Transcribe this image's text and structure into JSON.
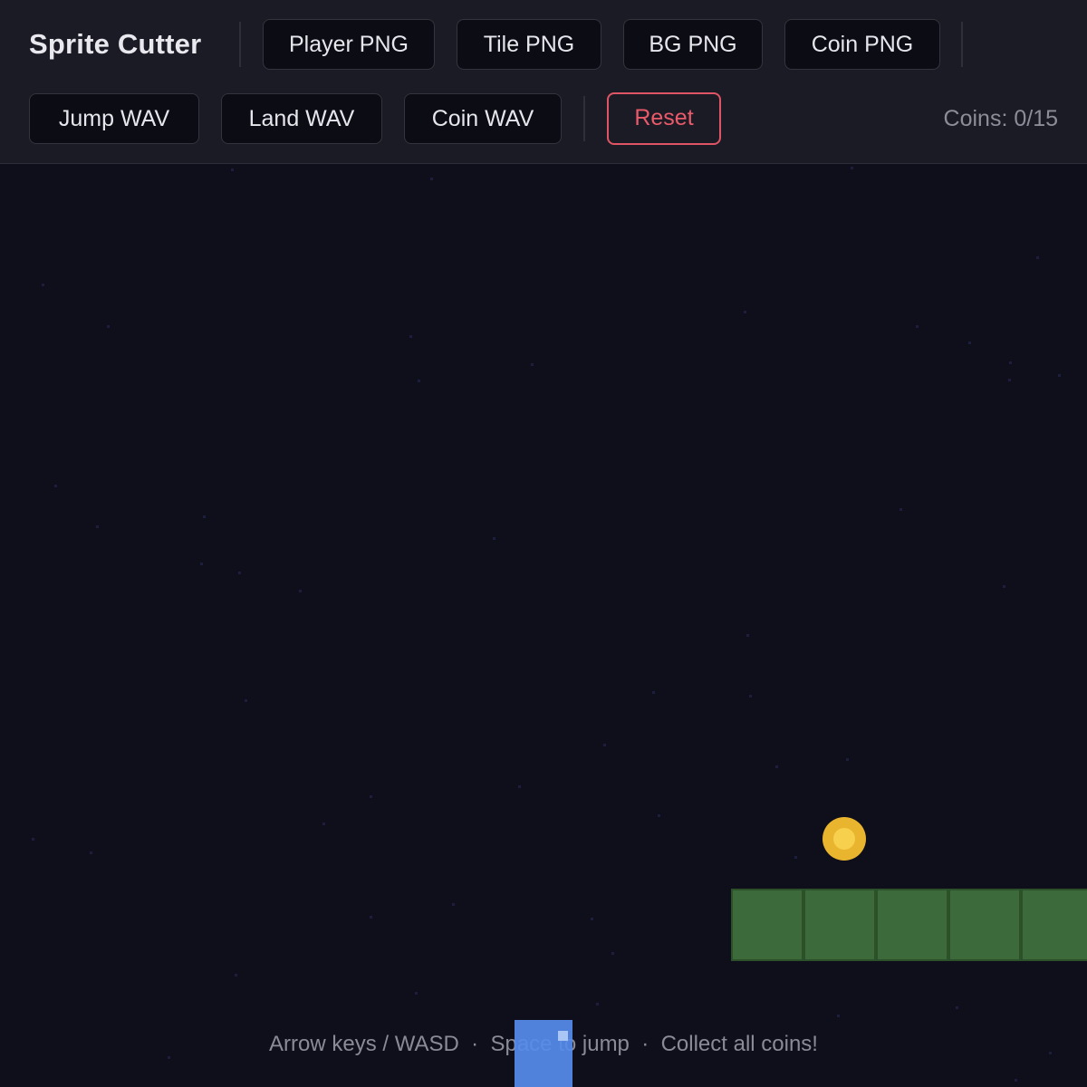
{
  "app": {
    "title": "Sprite Cutter"
  },
  "toolbar": {
    "image_buttons": [
      {
        "label": "Player PNG"
      },
      {
        "label": "Tile PNG"
      },
      {
        "label": "BG PNG"
      },
      {
        "label": "Coin PNG"
      }
    ],
    "audio_buttons": [
      {
        "label": "Jump WAV"
      },
      {
        "label": "Land WAV"
      },
      {
        "label": "Coin WAV"
      }
    ],
    "reset_label": "Reset",
    "coins_status": "Coins: 0/15"
  },
  "game": {
    "hint": "Arrow keys / WASD  ·  Space to jump  ·  Collect all coins!",
    "coins_collected": 0,
    "coins_total": 15
  },
  "colors": {
    "background": "#0f0f1b",
    "toolbar": "#1b1b25",
    "tile": "#3d6a3a",
    "coin": "#e9b42e",
    "player": "#568ceb",
    "danger": "#e05565"
  },
  "icons": {
    "coin": "coin-icon",
    "player": "player-sprite"
  }
}
